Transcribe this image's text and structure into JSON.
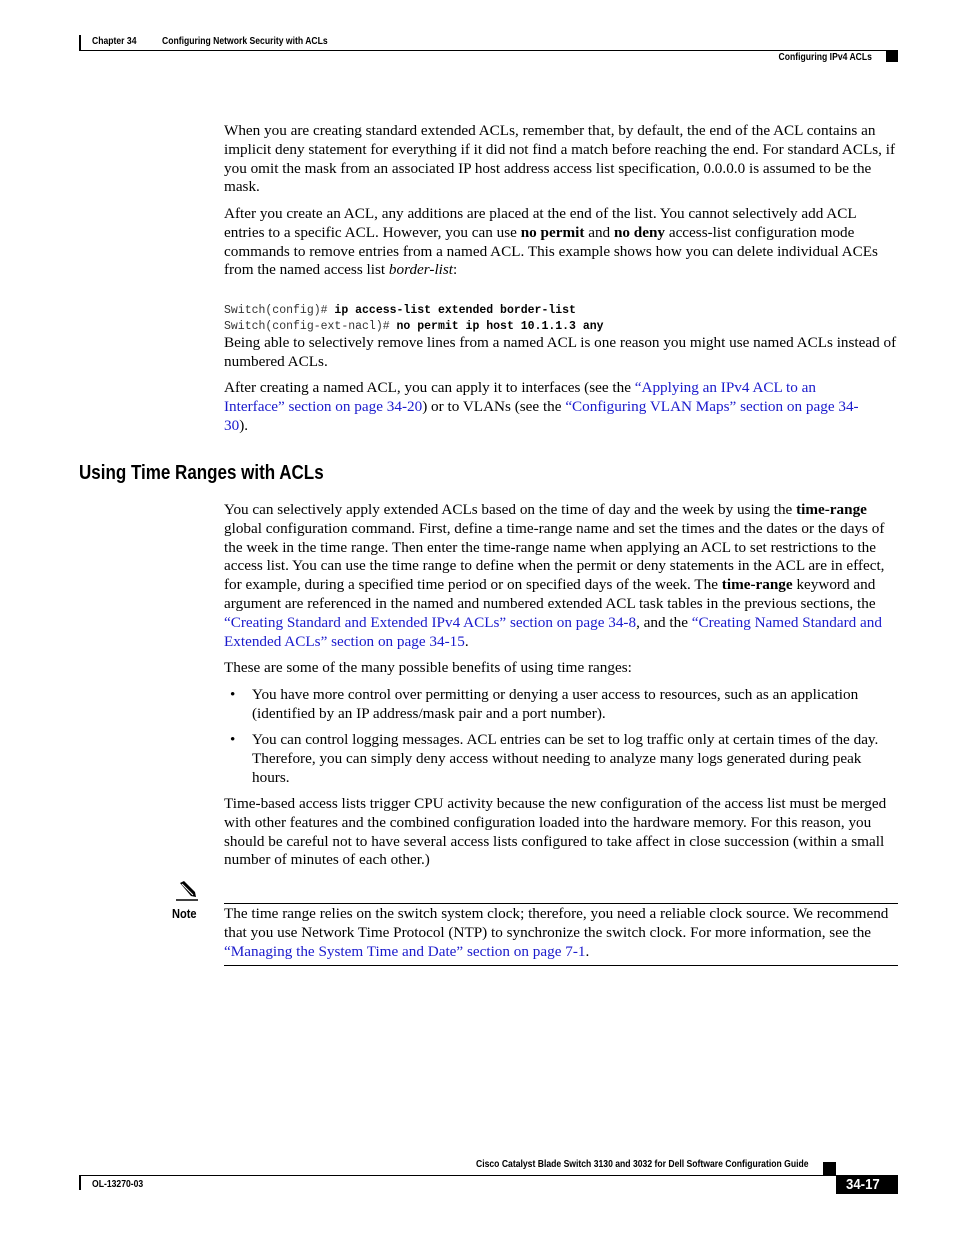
{
  "header": {
    "chapter": "Chapter 34",
    "chapter_title": "Configuring Network Security with ACLs",
    "section": "Configuring IPv4 ACLs"
  },
  "content": {
    "p1": "When you are creating standard extended ACLs, remember that, by default, the end of the ACL contains an implicit deny statement for everything if it did not find a match before reaching the end. For standard ACLs, if you omit the mask from an associated IP host address access list specification, 0.0.0.0 is assumed to be the mask.",
    "p2": {
      "t1": "After you create an ACL, any additions are placed at the end of the list. You cannot selectively add ACL entries to a specific ACL. However, you can use ",
      "b1": "no permit",
      "t2": " and ",
      "b2": "no deny",
      "t3": " access-list configuration mode commands to remove entries from a named ACL. This example shows how you can delete individual ACEs from the named access list ",
      "i1": "border-list",
      "t4": ":"
    },
    "code": [
      {
        "prompt": "Switch(config)# ",
        "cmd": "ip access-list extended border-list"
      },
      {
        "prompt": "Switch(config-ext-nacl)# ",
        "cmd": "no permit ip host 10.1.1.3 any"
      }
    ],
    "p3": "Being able to selectively remove lines from a named ACL is one reason you might use named ACLs instead of numbered ACLs.",
    "p4": {
      "t1": "After creating a named ACL, you can apply it to interfaces (see the ",
      "link1": "“Applying an IPv4 ACL to an Interface” section on page 34-20",
      "t2": ") or to VLANs (see the ",
      "link2": "“Configuring VLAN Maps” section on page 34-30",
      "t3": ")."
    },
    "heading": "Using Time Ranges with ACLs",
    "p5": {
      "t1": "You can selectively apply extended ACLs based on the time of day and the week by using the ",
      "b1": "time-range",
      "t2": " global configuration command. First, define a time-range name and set the times and the dates or the days of the week in the time range. Then enter the time-range name when applying an ACL to set restrictions to the access list. You can use the time range to define when the permit or deny statements in the ACL are in effect, for example, during a specified time period or on specified days of the week. The ",
      "b2": "time-range",
      "t3": " keyword and argument are referenced in the named and numbered extended ACL task tables in the previous sections, the ",
      "link1": "“Creating Standard and Extended IPv4 ACLs” section on page 34-8",
      "t4": ", and the ",
      "link2": "“Creating Named Standard and Extended ACLs” section on page 34-15",
      "t5": "."
    },
    "p6": "These are some of the many possible benefits of using time ranges:",
    "bullets": [
      "You have more control over permitting or denying a user access to resources, such as an application (identified by an IP address/mask pair and a port number).",
      "You can control logging messages. ACL entries can be set to log traffic only at certain times of the day. Therefore, you can simply deny access without needing to analyze many logs generated during peak hours."
    ],
    "bullet_char": "•",
    "p7": "Time-based access lists trigger CPU activity because the new configuration of the access list must be merged with other features and the combined configuration loaded into the hardware memory. For this reason, you should be careful not to have several access lists configured to take affect in close succession (within a small number of minutes of each other.)",
    "note": {
      "label": "Note",
      "t1": "The time range relies on the switch system clock; therefore, you need a reliable clock source. We recommend that you use Network Time Protocol (NTP) to synchronize the switch clock. For more information, see the ",
      "link1": "“Managing the System Time and Date” section on page 7-1",
      "t2": "."
    }
  },
  "footer": {
    "guide_title": "Cisco Catalyst Blade Switch 3130 and 3032 for Dell Software Configuration Guide",
    "doc_id": "OL-13270-03",
    "page_number": "34-17"
  },
  "colors": {
    "link": "#1a1acc"
  }
}
